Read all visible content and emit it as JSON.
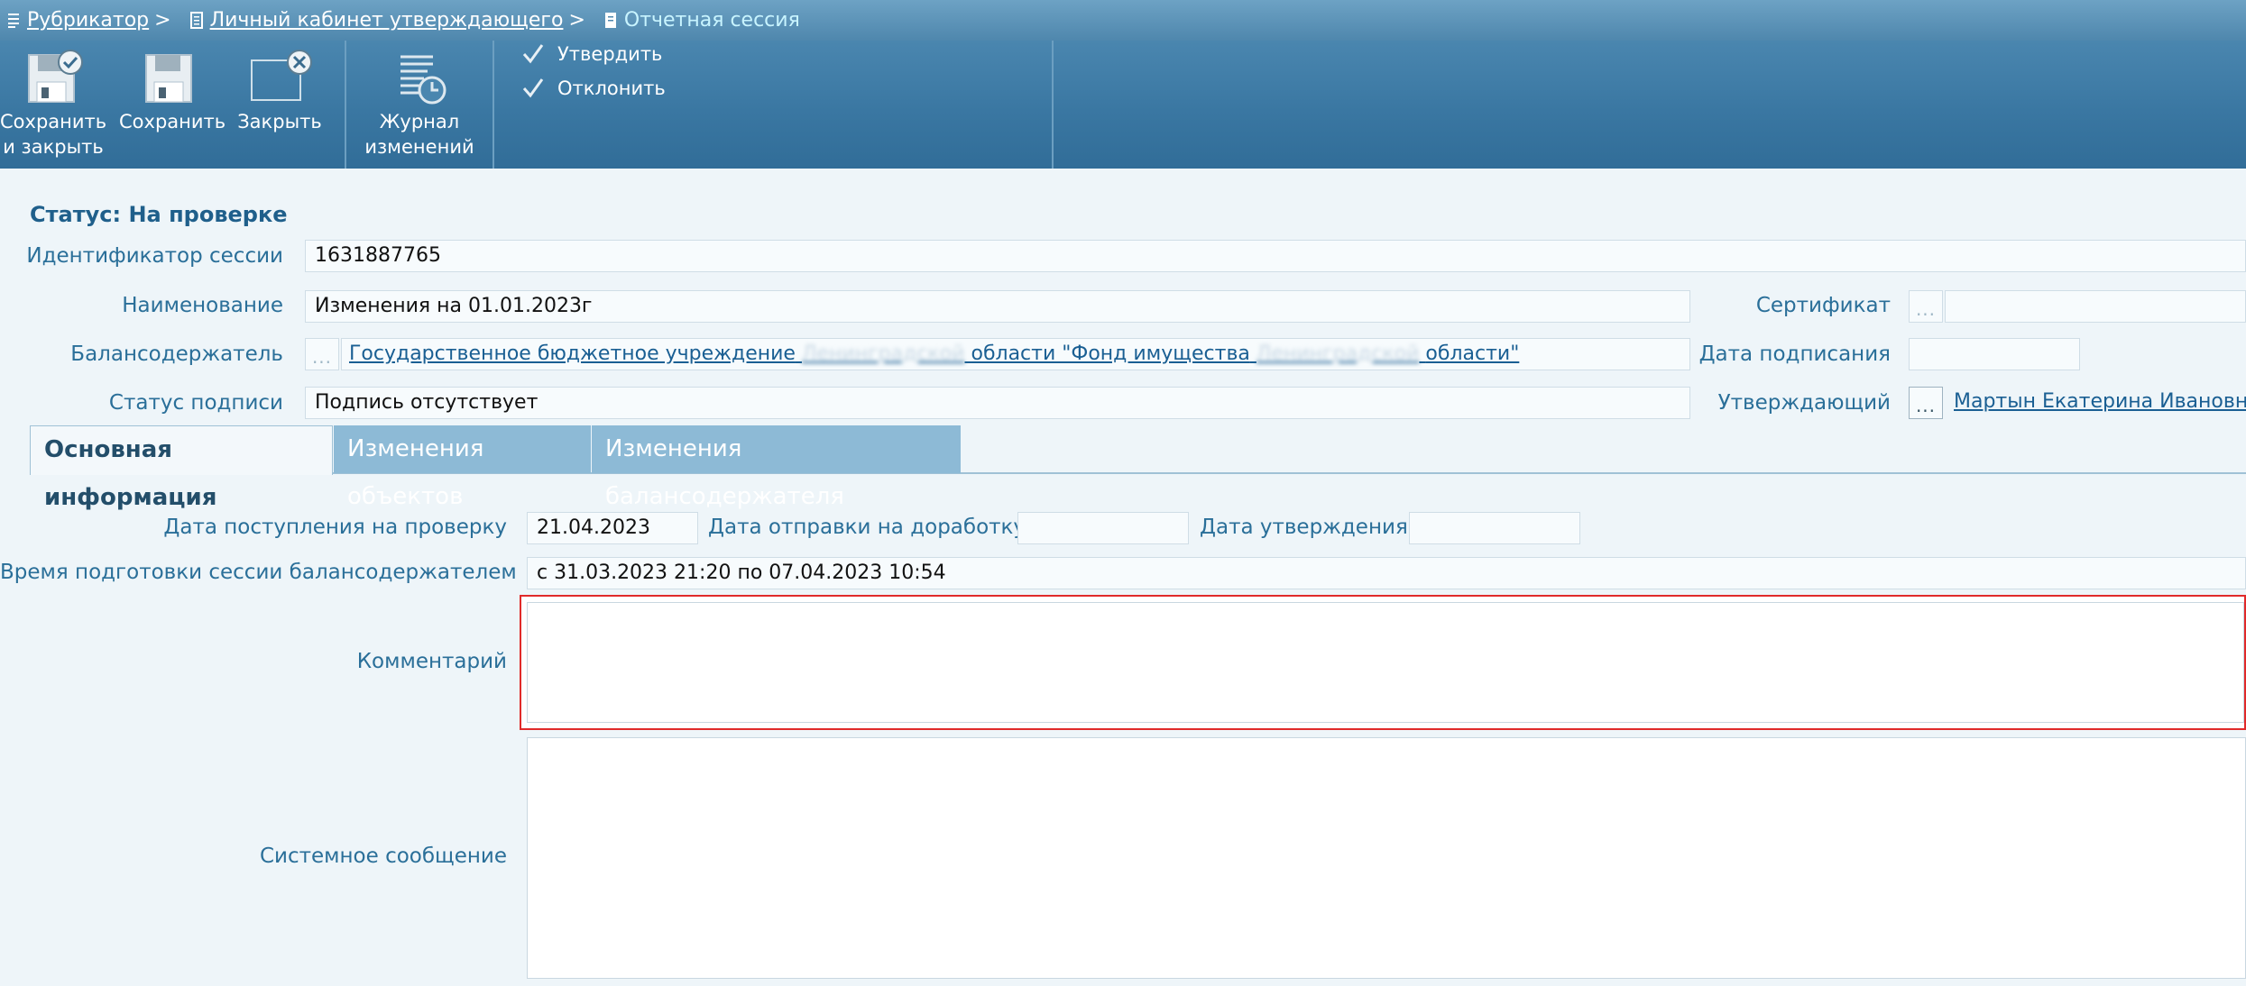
{
  "breadcrumb": {
    "items": [
      "Рубрикатор",
      "Личный кабинет утверждающего"
    ],
    "separator": ">",
    "current": "Отчетная сессия"
  },
  "toolbar": {
    "save_close_line1": "Сохранить",
    "save_close_line2": "и закрыть",
    "save": "Сохранить",
    "close": "Закрыть",
    "journal_line1": "Журнал",
    "journal_line2": "изменений",
    "approve": "Утвердить",
    "reject": "Отклонить"
  },
  "form": {
    "status_title": "Статус: На проверке",
    "session_id_label": "Идентификатор сессии",
    "session_id_value": "1631887765",
    "name_label": "Наименование",
    "name_value": "Изменения на 01.01.2023г",
    "holder_label": "Балансодержатель",
    "holder_part1": "Государственное бюджетное учреждение",
    "holder_blur1": "Ленинградской",
    "holder_part2": "области \"Фонд имущества",
    "holder_blur2": "Ленинградской",
    "holder_part3": "области\"",
    "sign_status_label": "Статус подписи",
    "sign_status_value": "Подпись отсутствует",
    "certificate_label": "Сертификат",
    "sign_date_label": "Дата подписания",
    "approver_label": "Утверждающий",
    "approver_value": "Мартын Екатерина Ивановна",
    "dots": "..."
  },
  "tabs": [
    "Основная информация",
    "Изменения объектов",
    "Изменения балансодержателя"
  ],
  "main_info": {
    "receipt_date_label": "Дата поступления на проверку",
    "receipt_date_value": "21.04.2023",
    "rework_date_label": "Дата отправки на доработку",
    "approval_date_label": "Дата утверждения",
    "prep_time_label": "Время подготовки сессии балансодержателем",
    "prep_time_value": "с 31.03.2023 21:20 по 07.04.2023 10:54",
    "comment_label": "Комментарий",
    "system_message_label": "Системное сообщение"
  }
}
